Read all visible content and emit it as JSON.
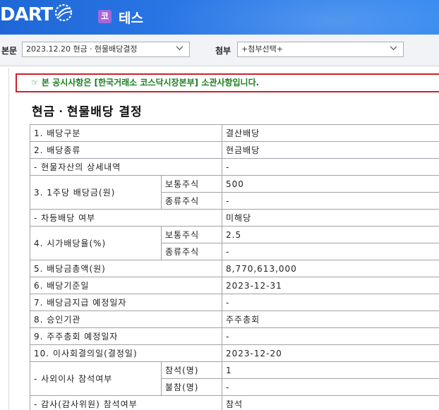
{
  "header": {
    "logo_text": "DART",
    "company_badge": "코",
    "company_name": "테스"
  },
  "toolbar": {
    "main_label": "본문",
    "main_select_value": "2023.12.20  현금ㆍ현물배당결정",
    "attach_label": "첨부",
    "attach_select_value": "+첨부선택+"
  },
  "notice": {
    "text": "☞ 본 공시사항은 [한국거래소 코스닥시장본부] 소관사항입니다."
  },
  "document": {
    "title": "현금ㆍ현물배당 결정",
    "rows": {
      "r1_label": "1. 배당구분",
      "r1_value": "결산배당",
      "r2_label": "2. 배당종류",
      "r2_value": "현금배당",
      "r2a_label": "- 현물자산의 상세내역",
      "r2a_value": "-",
      "r3_label": "3. 1주당 배당금(원)",
      "r3_sub1": "보통주식",
      "r3_val1": "500",
      "r3_sub2": "종류주식",
      "r3_val2": "-",
      "r3a_label": "- 차등배당 여부",
      "r3a_value": "미해당",
      "r4_label": "4. 시가배당율(%)",
      "r4_sub1": "보통주식",
      "r4_val1": "2.5",
      "r4_sub2": "종류주식",
      "r4_val2": "-",
      "r5_label": "5. 배당금총액(원)",
      "r5_value": "8,770,613,000",
      "r6_label": "6. 배당기준일",
      "r6_value": "2023-12-31",
      "r7_label": "7. 배당금지급 예정일자",
      "r7_value": "-",
      "r8_label": "8. 승인기관",
      "r8_value": "주주총회",
      "r9_label": "9. 주주총회 예정일자",
      "r9_value": "-",
      "r10_label": "10. 이사회결의일(결정일)",
      "r10_value": "2023-12-20",
      "r10a_label": "- 사외이사 참석여부",
      "r10a_sub1": "참석(명)",
      "r10a_val1": "1",
      "r10a_sub2": "불참(명)",
      "r10a_val2": "-",
      "r10b_label": "- 감사(감사위원) 참석여부",
      "r10b_value": "참석"
    }
  },
  "colors": {
    "header_blue": "#2a78e6",
    "notice_border": "#cc2229",
    "notice_text": "#1a7f20",
    "company_badge": "#a567d9"
  },
  "icons": {
    "logo_mark": "dart-swoosh-icon",
    "select_arrow": "chevron-down-icon"
  }
}
